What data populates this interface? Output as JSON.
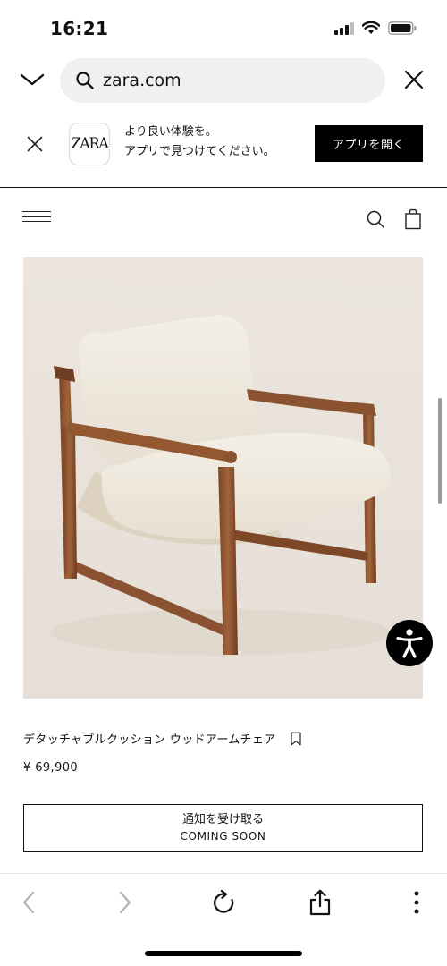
{
  "status_bar": {
    "time": "16:21"
  },
  "browser": {
    "url": "zara.com"
  },
  "app_banner": {
    "logo_text": "ZARA",
    "line1": "より良い体験を。",
    "line2": "アプリで見つけてください。",
    "open_button": "アプリを開く"
  },
  "product": {
    "name": "デタッチャブルクッション ウッドアームチェア",
    "price": "¥ 69,900",
    "notify_label": "通知を受け取る",
    "status": "COMING SOON"
  },
  "icons": {
    "status": [
      "signal-icon",
      "wifi-icon",
      "battery-icon"
    ],
    "toolbar": [
      "back-arrow-icon",
      "forward-arrow-icon",
      "reload-icon",
      "share-icon",
      "more-icon"
    ],
    "header": [
      "hamburger-menu-icon",
      "search-icon",
      "shopping-bag-icon"
    ]
  },
  "colors": {
    "accent": "#000000",
    "image_background": "#e9e3dc",
    "address_pill": "#f0f0f1"
  }
}
